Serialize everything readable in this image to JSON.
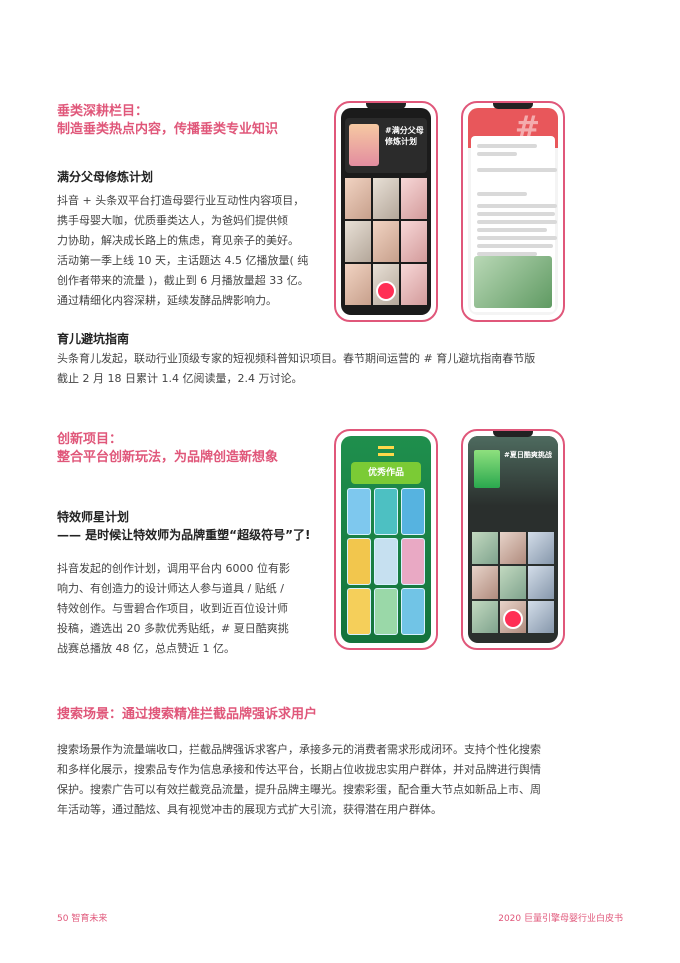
{
  "section1": {
    "heading_line1": "垂类深耕栏目：",
    "heading_line2": "制造垂类热点内容，传播垂类专业知识",
    "item1_title": "满分父母修炼计划",
    "item1_body": "抖音 + 头条双平台打造母婴行业互动性内容项目，\n携手母婴大咖，优质垂类达人，为爸妈们提供倾\n力协助，解决成长路上的焦虑，育见亲子的美好。\n活动第一季上线 10 天，主话题达 4.5 亿播放量( 纯\n创作者带来的流量 )，截止到 6 月播放量超 33 亿。\n通过精细化内容深耕，延续发酵品牌影响力。",
    "item2_title": "育儿避坑指南",
    "item2_body": "头条育儿发起，联动行业顶级专家的短视频科普知识项目。春节期间运营的 # 育儿避坑指南春节版\n截止 2 月 18 日累计 1.4 亿阅读量，2.4 万讨论。"
  },
  "section2": {
    "heading_line1": "创新项目：",
    "heading_line2": "整合平台创新玩法，为品牌创造新想象",
    "item_title": "特效师星计划",
    "item_subtitle": "—— 是时候让特效师为品牌重塑“超级符号”了!",
    "item_body": "抖音发起的创作计划，调用平台内 6000 位有影\n响力、有创造力的设计师达人参与道具 / 贴纸 /\n特效创作。与雪碧合作项目，收到近百位设计师\n投稿，遴选出 20 多款优秀贴纸，# 夏日酷爽挑\n战赛总播放 48 亿，总点赞近 1 亿。"
  },
  "section3": {
    "heading": "搜索场景：通过搜索精准拦截品牌强诉求用户",
    "body": "搜索场景作为流量端收口，拦截品牌强诉求客户，承接多元的消费者需求形成闭环。支持个性化搜索\n和多样化展示，搜索品专作为信息承接和传达平台，长期占位收拢忠实用户群体，并对品牌进行舆情\n保护。搜索广告可以有效拦截竞品流量，提升品牌主曝光。搜索彩蛋，配合重大节点如新品上市、周\n年活动等，通过酷炫、具有视觉冲击的展现方式扩大引流，获得潜在用户群体。"
  },
  "phones": {
    "p1_tag": "#满分父母修炼计划",
    "p3_header": "优秀作品",
    "p4_tag": "#夏日酷爽挑战"
  },
  "footer": {
    "left": "50 智育未来",
    "right": "2020 巨量引擎母婴行业白皮书"
  },
  "colors": {
    "accent": "#e0577a"
  }
}
